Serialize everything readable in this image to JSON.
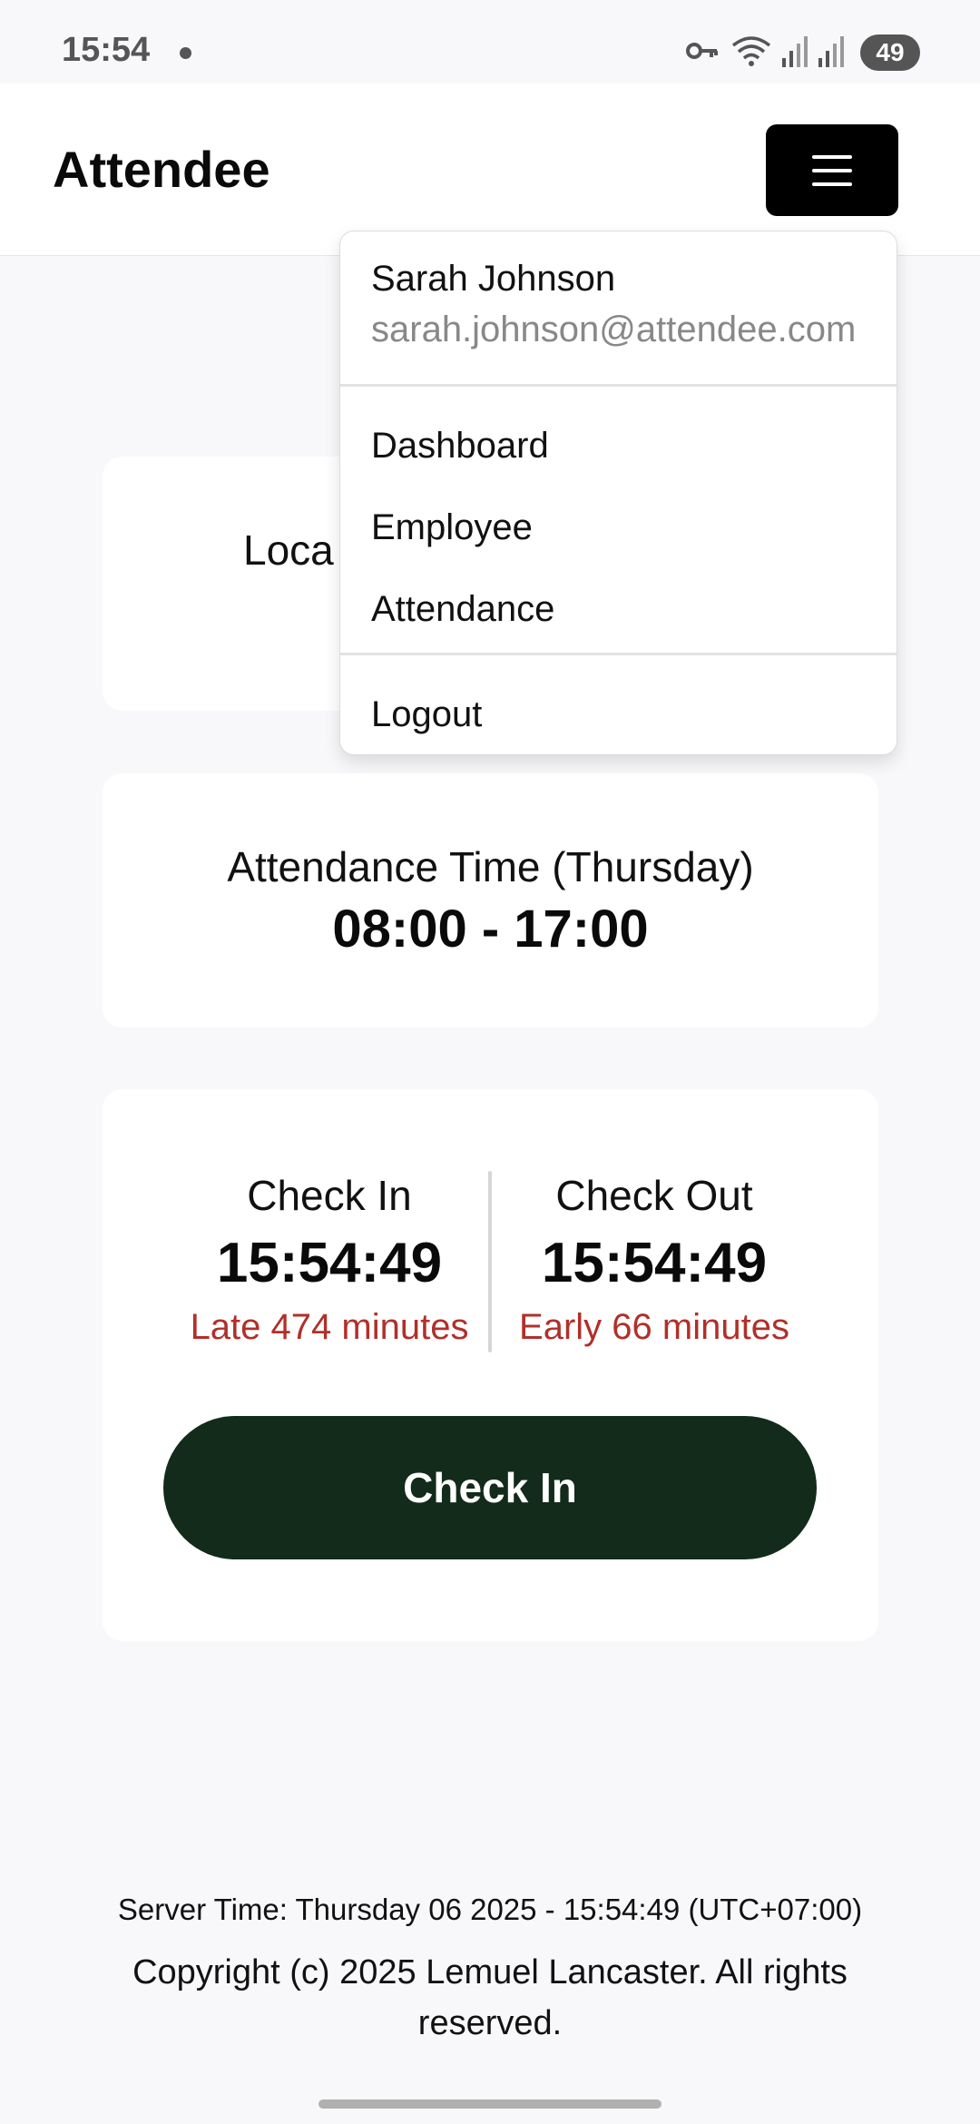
{
  "status_bar": {
    "time": "15:54",
    "battery": "49",
    "icons": [
      "key-icon",
      "wifi-icon",
      "signal-icon",
      "signal-icon"
    ]
  },
  "header": {
    "brand": "Attendee",
    "menu_icon": "hamburger-icon"
  },
  "dropdown": {
    "user_name": "Sarah Johnson",
    "user_email": "sarah.johnson@attendee.com",
    "items": [
      "Dashboard",
      "Employee",
      "Attendance"
    ],
    "logout": "Logout"
  },
  "location_card": {
    "label_partial": "Loca"
  },
  "schedule": {
    "label": "Attendance Time (Thursday)",
    "value": "08:00 - 17:00"
  },
  "check": {
    "in_label": "Check In",
    "in_time": "15:54:49",
    "in_status": "Late 474 minutes",
    "out_label": "Check Out",
    "out_time": "15:54:49",
    "out_status": "Early 66 minutes",
    "button_label": "Check In"
  },
  "footer": {
    "server_time": "Server Time: Thursday 06 2025 - 15:54:49 (UTC+07:00)",
    "copyright": "Copyright (c) 2025 Lemuel Lancaster. All rights reserved."
  },
  "colors": {
    "accent_dark_green": "#132b1a",
    "status_red": "#b0302a"
  }
}
